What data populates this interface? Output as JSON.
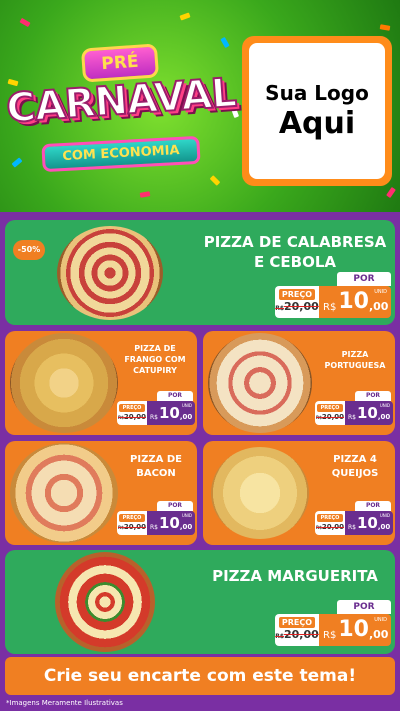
{
  "header": {
    "pre": "PRÉ",
    "carnaval": "CARNAVAL",
    "economia": "COM ECONOMIA",
    "logo_line1": "Sua Logo",
    "logo_line2": "Aqui"
  },
  "discount_badge": "-50%",
  "por_label": "POR",
  "preco_label": "PREÇO",
  "old_price": "20,00",
  "old_currency": "R$",
  "currency": "R$",
  "new_int": "10",
  "new_cents": ",00",
  "unit": "UNID",
  "products": [
    {
      "name_l1": "PIZZA DE CALABRESA",
      "name_l2": "E CEBOLA"
    },
    {
      "name_l1": "PIZZA DE",
      "name_l2": "FRANGO COM",
      "name_l3": "CATUPIRY"
    },
    {
      "name_l1": "PIZZA",
      "name_l2": "PORTUGUESA"
    },
    {
      "name_l1": "PIZZA DE",
      "name_l2": "BACON"
    },
    {
      "name_l1": "PIZZA 4",
      "name_l2": "QUEIJOS"
    },
    {
      "name_l1": "PIZZA MARGUERITA"
    }
  ],
  "footer": {
    "cta": "Crie seu encarte com este tema!",
    "disclaimer": "*Imagens Meramente Ilustrativas"
  },
  "colors": {
    "green": "#2faa5c",
    "orange": "#f07f22",
    "purple": "#6a2d8f"
  }
}
